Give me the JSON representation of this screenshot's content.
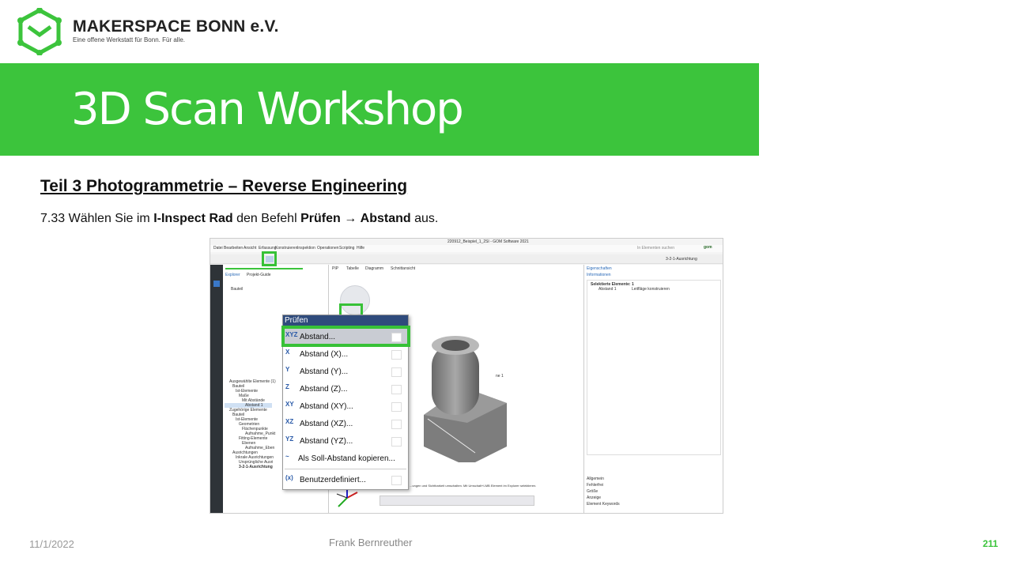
{
  "logo": {
    "name": "MAKERSPACE BONN e.V.",
    "tagline": "Eine offene Werkstatt für Bonn. Für alle."
  },
  "banner": {
    "title": "3D Scan Workshop"
  },
  "section": {
    "heading": "Teil 3  Photogrammetrie  – Reverse Engineering"
  },
  "step": {
    "number": "7.33",
    "text_before": "Wählen Sie im",
    "wheel": "I-Inspect Rad",
    "text_mid": "den Befehl",
    "command": "Prüfen",
    "arrow": "→",
    "target": "Abstand",
    "text_after": "aus."
  },
  "screenshot": {
    "window_title": "220912_Beispiel_1_2SI - GOM Software 2021",
    "menu_items": [
      "Datei",
      "Bearbeiten",
      "Ansicht",
      "Erfassung",
      "Konstruieren",
      "Inspektion",
      "Operationen",
      "Scripting",
      "Hilfe"
    ],
    "search_placeholder": "In Elementen suchen",
    "alignment": "3-2-1-Ausrichtung",
    "view_tabs": [
      "PIP",
      "Tabelle",
      "Diagramm",
      "Schnittansicht"
    ],
    "left_tabs": [
      "Explorer",
      "Projekt-Guide"
    ],
    "right_tabs": [
      "Eigenschaften",
      "Informationen"
    ],
    "props_heading": "Selektierte Elemente: 1",
    "props_row": [
      "Abstand 1",
      "Leitfläge konstruieren"
    ],
    "tree_top": [
      "Bauteil"
    ],
    "tree_bottom": [
      "Ausgewählte Elemente (1)",
      "Bauteil",
      "Ist-Elemente",
      "Maße",
      "Mit Abstände",
      "Abstand 1",
      "Zugehörige Elemente",
      "Bauteil",
      "Ist-Elemente",
      "Geometrien",
      "Flächenpunkte",
      "Aufnahme_Punkt",
      "Fitting-Elemente",
      "Ebenen",
      "Aufnahme_Eben",
      "Ausrichtungen",
      "Inkrale Ausrichtungen",
      "Ursprüngliche Ausri",
      "3-2-1-Ausrichtung"
    ],
    "right_bottom": [
      "Allgemein",
      "Fehlerfrei",
      "Größe",
      "Anzeige",
      "Element Keywords"
    ],
    "status_hint": "...ungen und Sichtbarkeit umschalten. Mit Umschalt+LMB Element im Explorer selektieren.",
    "label_3": "ne 1",
    "popup": {
      "header": "Prüfen",
      "items": [
        {
          "icon": "XYZ",
          "label": "Abstand..."
        },
        {
          "icon": "X",
          "label": "Abstand (X)..."
        },
        {
          "icon": "Y",
          "label": "Abstand (Y)..."
        },
        {
          "icon": "Z",
          "label": "Abstand (Z)..."
        },
        {
          "icon": "XY",
          "label": "Abstand (XY)..."
        },
        {
          "icon": "XZ",
          "label": "Abstand (XZ)..."
        },
        {
          "icon": "YZ",
          "label": "Abstand (YZ)..."
        },
        {
          "icon": "~",
          "label": "Als Soll-Abstand kopieren..."
        },
        {
          "icon": "(x)",
          "label": "Benutzerdefiniert..."
        }
      ]
    }
  },
  "footer": {
    "date": "11/1/2022",
    "author": "Frank Bernreuther",
    "page": "211"
  },
  "colors": {
    "brand_green": "#3cc43c",
    "highlight_green": "#37c137",
    "menu_header": "#2f4b7c"
  }
}
